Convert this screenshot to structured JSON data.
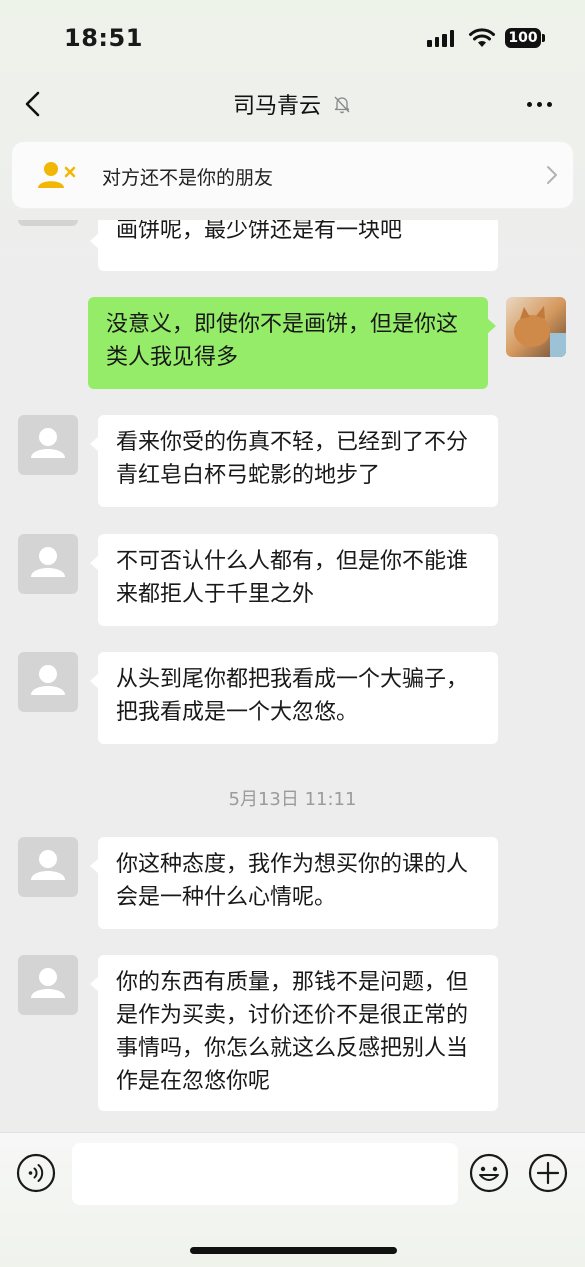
{
  "status_bar": {
    "time": "18:51",
    "battery": "100"
  },
  "nav": {
    "title": "司马青云"
  },
  "notice": {
    "text": "对方还不是你的朋友"
  },
  "messages": [
    {
      "from": "them",
      "text": "画饼呢，最少饼还是有一块吧"
    },
    {
      "from": "me",
      "text": "没意义，即使你不是画饼，但是你这类人我见得多"
    },
    {
      "from": "them",
      "text": "看来你受的伤真不轻，已经到了不分青红皂白杯弓蛇影的地步了"
    },
    {
      "from": "them",
      "text": "不可否认什么人都有，但是你不能谁来都拒人于千里之外"
    },
    {
      "from": "them",
      "text": "从头到尾你都把我看成一个大骗子，把我看成是一个大忽悠。"
    },
    {
      "from": "them",
      "text": "你这种态度，我作为想买你的课的人会是一种什么心情呢。"
    },
    {
      "from": "them",
      "text": "你的东西有质量，那钱不是问题，但是作为买卖，讨价还价不是很正常的事情吗，你怎么就这么反感把别人当作是在忽悠你呢"
    }
  ],
  "timestamp": "5月13日 11:11",
  "input": {
    "value": ""
  },
  "colors": {
    "outgoing_bubble": "#95ec69",
    "incoming_bubble": "#ffffff",
    "background": "#ededed",
    "notice_icon": "#f2b705"
  },
  "icons": {
    "back": "chevron-left-icon",
    "mute": "bell-slash-icon",
    "more": "ellipsis-icon",
    "notice": "add-contact-icon",
    "voice": "voice-icon",
    "emoji": "emoji-icon",
    "plus": "plus-icon"
  }
}
